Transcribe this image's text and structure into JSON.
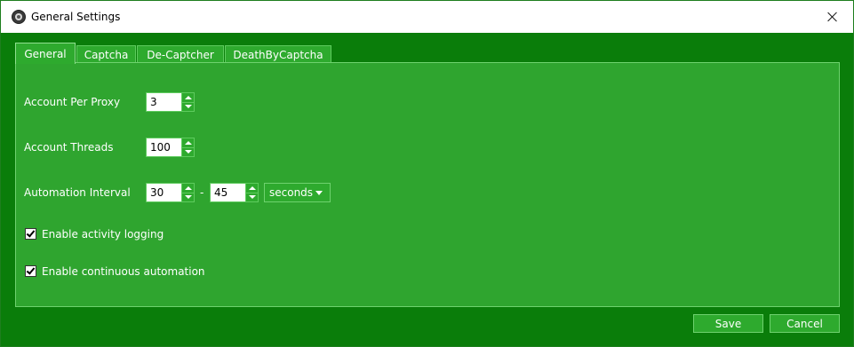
{
  "window": {
    "title": "General Settings"
  },
  "tabs": [
    {
      "label": "General",
      "active": true
    },
    {
      "label": "Captcha",
      "active": false
    },
    {
      "label": "De-Captcher",
      "active": false
    },
    {
      "label": "DeathByCaptcha",
      "active": false
    }
  ],
  "general": {
    "account_per_proxy": {
      "label": "Account Per Proxy",
      "value": "3"
    },
    "account_threads": {
      "label": "Account Threads",
      "value": "100"
    },
    "automation_interval": {
      "label": "Automation Interval",
      "min": "30",
      "separator": "-",
      "max": "45",
      "unit": "seconds"
    },
    "activity_logging": {
      "label": "Enable activity logging",
      "checked": true
    },
    "continuous_automation": {
      "label": "Enable continuous automation",
      "checked": true
    }
  },
  "footer": {
    "save_label": "Save",
    "cancel_label": "Cancel"
  },
  "colors": {
    "window_bg": "#0a7d0a",
    "panel_bg": "#2fa52f",
    "border": "#6ed26e"
  }
}
